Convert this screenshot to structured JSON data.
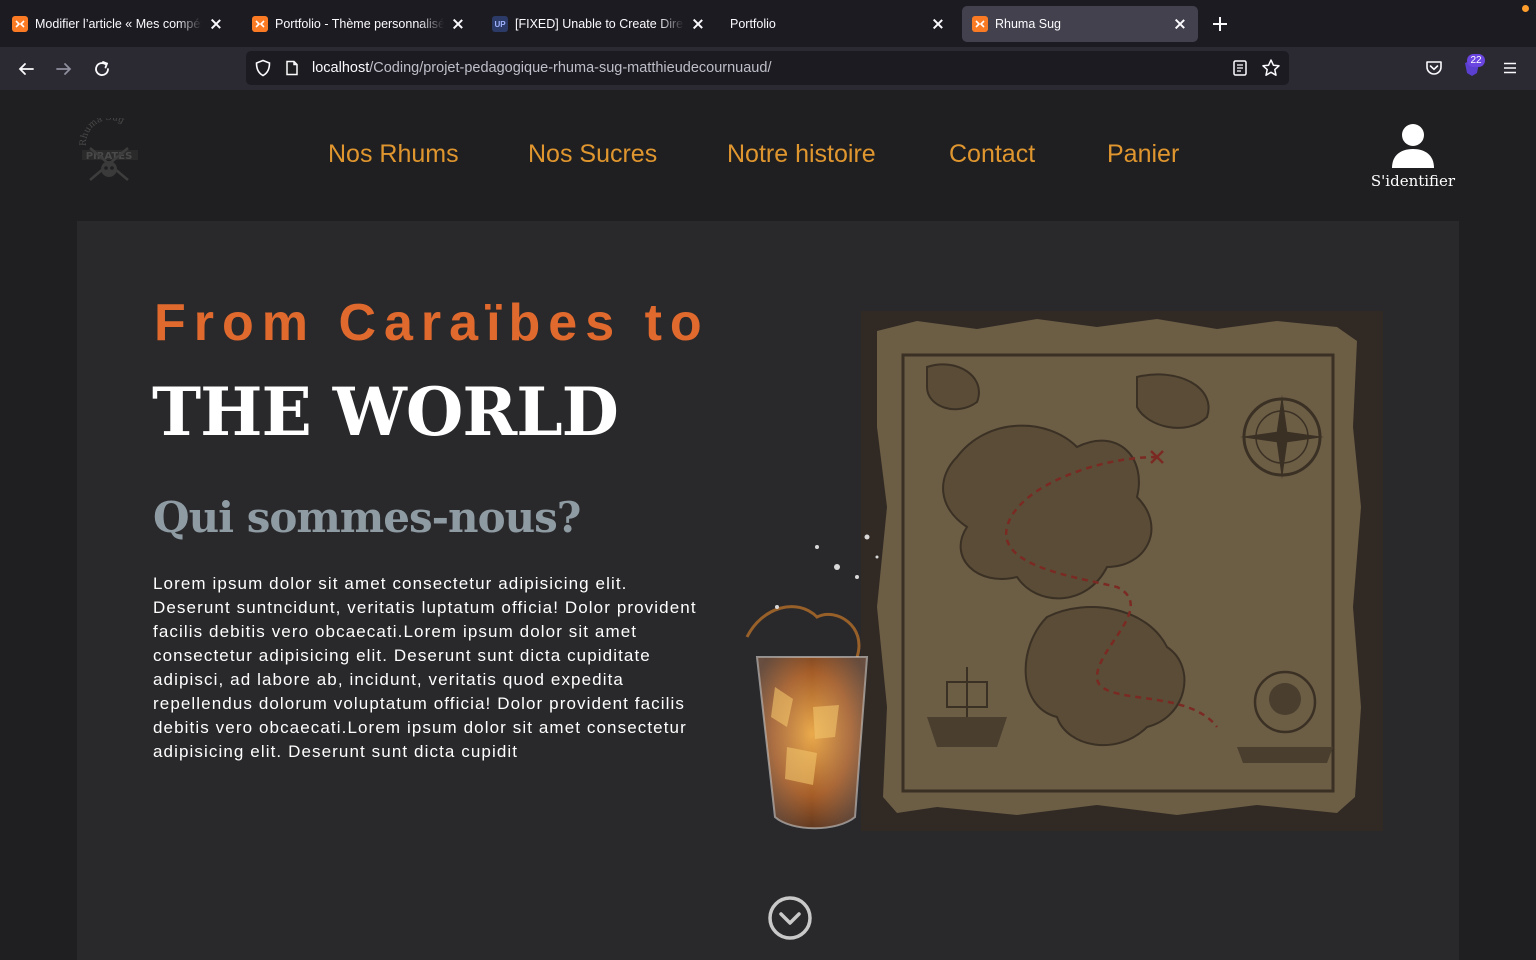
{
  "browser": {
    "tabs": [
      {
        "title": "Modifier l’article « Mes compétences",
        "favicon": "xampp-icon",
        "active": false
      },
      {
        "title": "Portfolio - Thème personnalisé – WordPress",
        "favicon": "xampp-icon",
        "active": false
      },
      {
        "title": "[FIXED] Unable to Create Directory",
        "favicon": "up-icon",
        "active": false
      },
      {
        "title": "Portfolio",
        "favicon": "",
        "active": false
      },
      {
        "title": "Rhuma Sug",
        "favicon": "xampp-icon",
        "active": true
      }
    ],
    "url_host": "localhost",
    "url_path": "/Coding/projet-pedagogique-rhuma-sug-matthieudecournuaud/",
    "extension_badge": "22",
    "accent_color": "#fb7a24"
  },
  "site": {
    "nav": [
      "Nos Rhums",
      "Nos Sucres",
      "Notre histoire",
      "Contact",
      "Panier"
    ],
    "signin_label": "S'identifier",
    "nav_color": "#e0962e"
  },
  "hero": {
    "eyebrow": "From Caraïbes to",
    "headline": "THE WORLD",
    "subheading": "Qui sommes-nous?",
    "body": "Lorem ipsum dolor sit amet consectetur adipisicing elit. Deserunt suntncidunt, veritatis luptatum officia! Dolor provident facilis debitis vero obcaecati.Lorem ipsum dolor sit amet consectetur adipisicing elit. Deserunt sunt dicta cupiditate adipisci, ad labore ab, incidunt, veritatis quod expedita repellendus dolorum voluptatum officia! Dolor provident facilis debitis vero obcaecati.Lorem ipsum dolor sit amet consectetur adipisicing elit. Deserunt sunt dicta cupidit",
    "eyebrow_color": "#e06a2e",
    "subheading_color": "#8e9ba3"
  }
}
